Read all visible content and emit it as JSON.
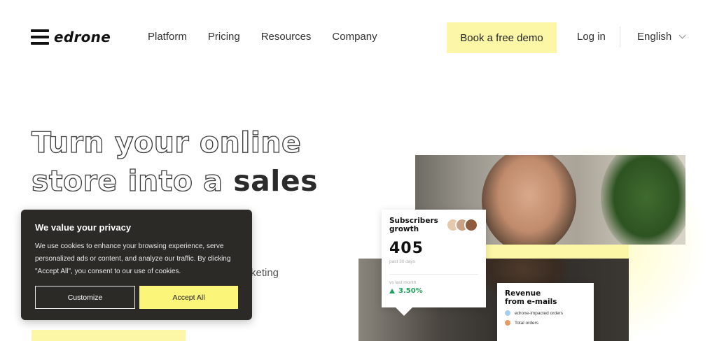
{
  "brand": {
    "logo_text": "edrone"
  },
  "nav": {
    "items": [
      "Platform",
      "Pricing",
      "Resources",
      "Company"
    ]
  },
  "header": {
    "demo_button": "Book a free demo",
    "login": "Log in",
    "language": "English"
  },
  "hero": {
    "line1": "Turn your online",
    "line2_outline": "store into a ",
    "line2_solid": "sales",
    "partial_text": "keting"
  },
  "cards": {
    "subscribers": {
      "title_line1": "Subscribers",
      "title_line2": "growth",
      "value": "405",
      "period": "past 30 days",
      "compare": "vs last month",
      "growth": "3.50%"
    },
    "revenue": {
      "title_line1": "Revenue",
      "title_line2": "from e-mails",
      "legend": [
        {
          "label": "edrone-impacted orders",
          "color": "#a9cdea"
        },
        {
          "label": "Total orders",
          "color": "#e79a6a"
        }
      ]
    }
  },
  "cookie": {
    "title": "We value your privacy",
    "body": "We use cookies to enhance your browsing experience, serve personalized ads or content, and analyze our traffic. By clicking \"Accept All\", you consent to our use of cookies.",
    "customize": "Customize",
    "accept": "Accept All"
  },
  "colors": {
    "accent_yellow": "#fbf7a6",
    "cookie_bg": "#2b2a27",
    "growth_green": "#1fa25a"
  }
}
